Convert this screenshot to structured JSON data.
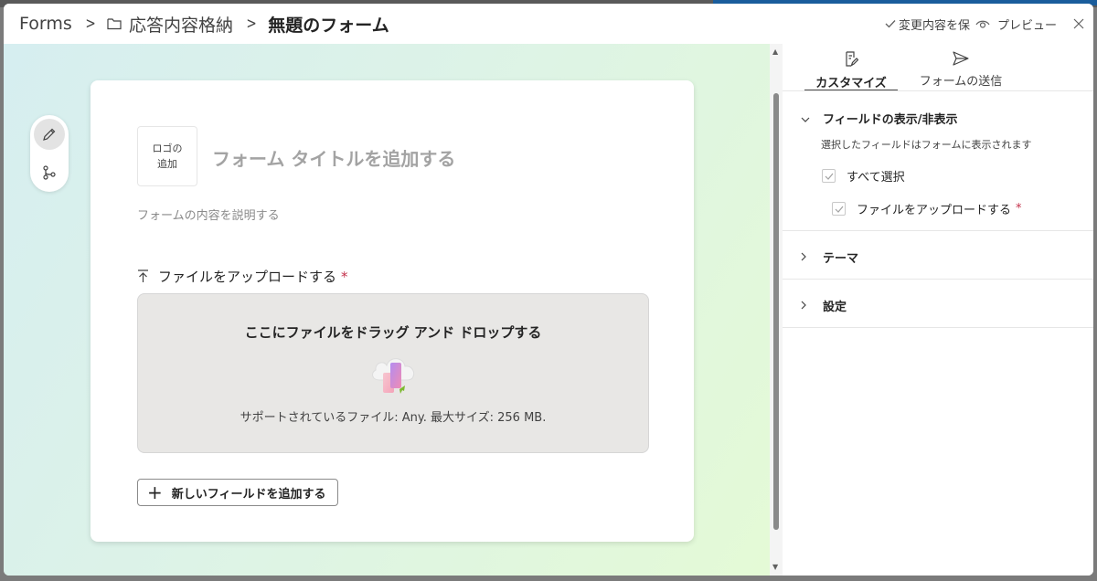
{
  "breadcrumb": {
    "app": "Forms",
    "folder": "応答内容格納",
    "current": "無題のフォーム"
  },
  "header": {
    "save_label": "変更内容を保",
    "preview_label": "プレビュー"
  },
  "form": {
    "logo_line1": "ロゴの",
    "logo_line2": "追加",
    "title_placeholder": "フォーム タイトルを追加する",
    "description_placeholder": "フォームの内容を説明する",
    "field": {
      "label": "ファイルをアップロードする",
      "required_mark": "*",
      "dropzone_title": "ここにファイルをドラッグ アンド ドロップする",
      "supported_text": "サポートされているファイル: Any. 最大サイズ: 256 MB."
    },
    "add_field_label": "新しいフィールドを追加する"
  },
  "panel": {
    "tabs": [
      {
        "label": "カスタマイズ",
        "icon": "customize-icon",
        "active": true
      },
      {
        "label": "フォームの送信",
        "icon": "send-icon",
        "active": false
      }
    ],
    "sections": {
      "fields": {
        "title": "フィールドの表示/非表示",
        "description": "選択したフィールドはフォームに表示されます",
        "select_all": "すべて選択",
        "field_item": "ファイルをアップロードする",
        "required_mark": "*"
      },
      "theme": {
        "title": "テーマ"
      },
      "settings": {
        "title": "設定"
      }
    }
  },
  "colors": {
    "required": "#c4314b",
    "canvas_gradient_start": "#d6eef0",
    "canvas_gradient_end": "#e4fad6"
  }
}
